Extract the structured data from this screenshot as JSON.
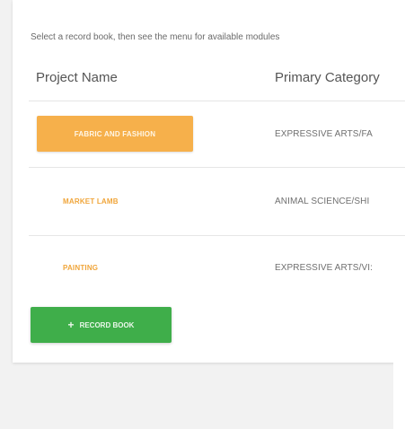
{
  "instructions": "Select a record book, then see the menu for available modules",
  "table": {
    "headers": {
      "name": "Project Name",
      "category": "Primary Category"
    },
    "rows": [
      {
        "name": "FABRIC AND FASHION",
        "category": "EXPRESSIVE ARTS/FA",
        "selected": true
      },
      {
        "name": "MARKET LAMB",
        "category": "ANIMAL SCIENCE/SHI",
        "selected": false
      },
      {
        "name": "PAINTING",
        "category": "EXPRESSIVE ARTS/VI:",
        "selected": false
      }
    ]
  },
  "add_button": {
    "icon": "plus-icon",
    "label": "RECORD BOOK"
  },
  "colors": {
    "accent_orange": "#f6b04b",
    "link_orange": "#f0a53a",
    "green": "#3fae4a"
  }
}
